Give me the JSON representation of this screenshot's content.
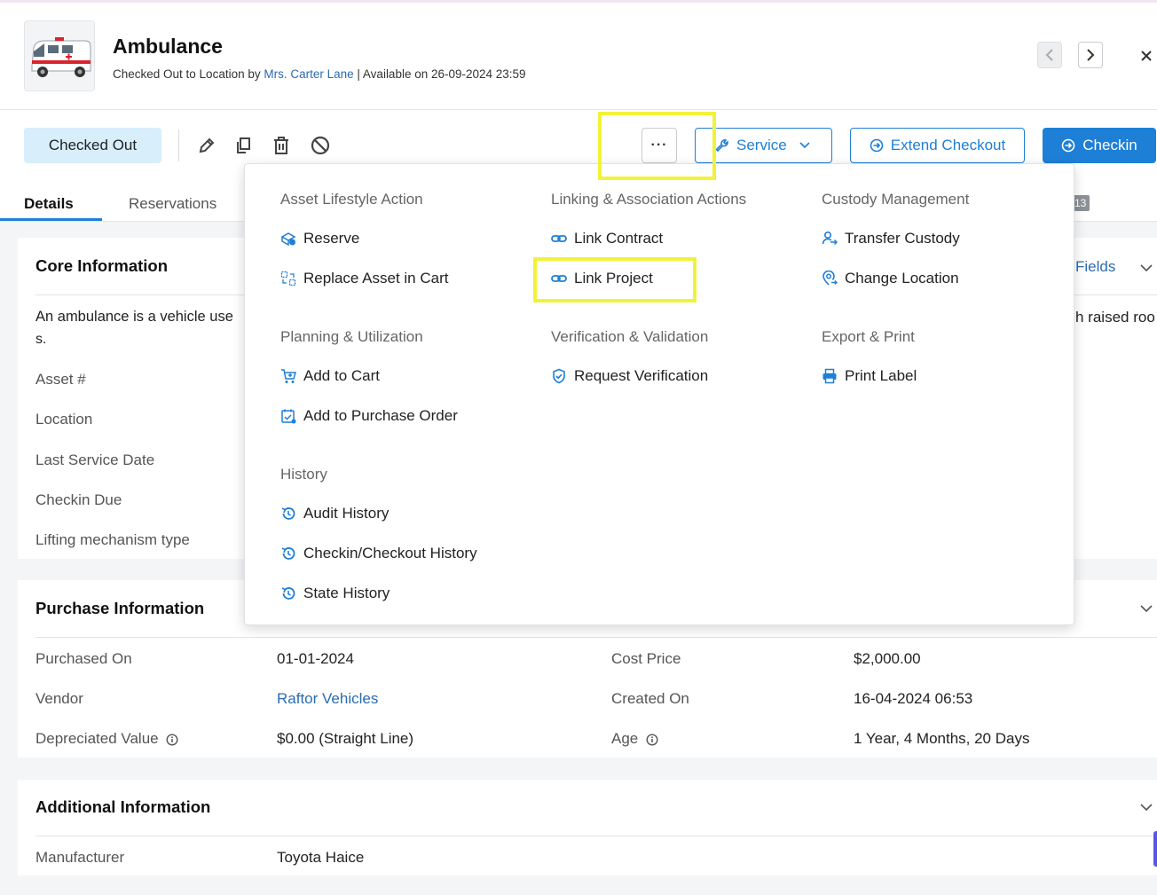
{
  "asset": {
    "name": "Ambulance",
    "status_prefix": "Checked Out to Location by ",
    "checked_out_by": "Mrs. Carter Lane",
    "status_suffix": " | Available on 26-09-2024 23:59",
    "status": "Checked Out"
  },
  "actions": {
    "more": "···",
    "service": "Service",
    "extend_checkout": "Extend Checkout",
    "checkin": "Checkin"
  },
  "tabs": [
    {
      "label": "Details",
      "active": true
    },
    {
      "label": "Reservations",
      "active": false
    }
  ],
  "tab_badge": "13",
  "core": {
    "title": "Core Information",
    "fields_link": "Fields",
    "description_start": "An ambulance is a vehicle use",
    "description_end": "h raised roo",
    "description_line2": "s.",
    "labels": [
      "Asset #",
      "Location",
      "Last Service Date",
      "Checkin Due",
      "Lifting mechanism type"
    ]
  },
  "purchase": {
    "title": "Purchase Information",
    "rows": [
      {
        "label": "Purchased On",
        "value": "01-01-2024",
        "label2": "Cost Price",
        "value2": "$2,000.00"
      },
      {
        "label": "Vendor",
        "value": "Raftor Vehicles",
        "label2": "Created On",
        "value2": "16-04-2024 06:53"
      },
      {
        "label": "Depreciated Value",
        "value": "$0.00 (Straight Line)",
        "label2": "Age",
        "value2": "1 Year, 4 Months, 20 Days"
      }
    ]
  },
  "additional": {
    "title": "Additional Information",
    "manufacturer_label": "Manufacturer",
    "manufacturer_value": "Toyota Haice"
  },
  "menu": {
    "asset_lifecycle": {
      "heading": "Asset Lifestyle Action",
      "items": [
        "Reserve",
        "Replace Asset in Cart"
      ]
    },
    "planning": {
      "heading": "Planning & Utilization",
      "items": [
        "Add to Cart",
        "Add to Purchase Order"
      ]
    },
    "history": {
      "heading": "History",
      "items": [
        "Audit History",
        "Checkin/Checkout History",
        "State History"
      ]
    },
    "linking": {
      "heading": "Linking & Association Actions",
      "items": [
        "Link Contract",
        "Link Project"
      ]
    },
    "verification": {
      "heading": "Verification & Validation",
      "items": [
        "Request Verification"
      ]
    },
    "custody": {
      "heading": "Custody Management",
      "items": [
        "Transfer Custody",
        "Change Location"
      ]
    },
    "export": {
      "heading": "Export & Print",
      "items": [
        "Print Label"
      ]
    }
  },
  "colors": {
    "accent": "#1e7fd6",
    "highlight": "#f2f23a",
    "status_pill": "#d8eefb"
  }
}
